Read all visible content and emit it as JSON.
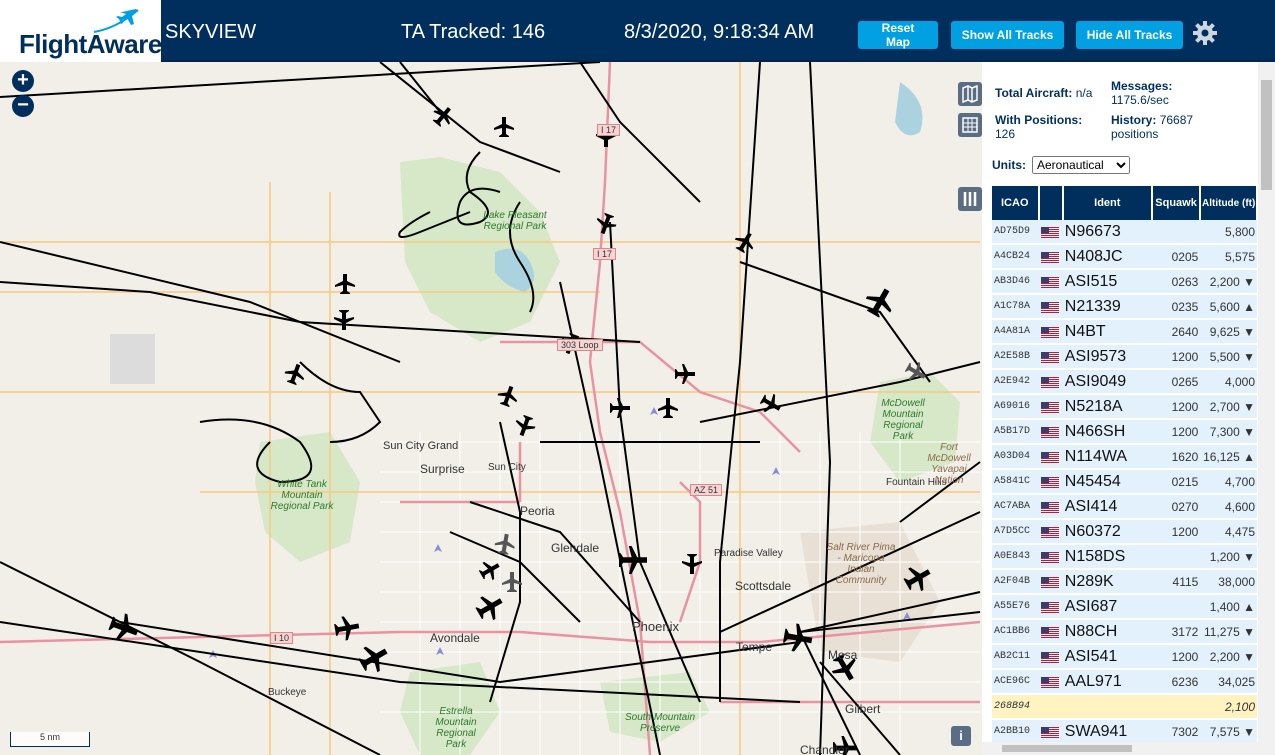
{
  "header": {
    "logo": "FlightAware",
    "app_name": "SKYVIEW",
    "tracked": "TA Tracked: 146",
    "datetime": "8/3/2020, 9:18:34 AM",
    "reset_map": "Reset Map",
    "show_tracks": "Show All Tracks",
    "hide_tracks": "Hide All Tracks"
  },
  "map": {
    "zoom_in": "+",
    "zoom_out": "−",
    "scale": "5 nm",
    "info": "i",
    "places": [
      "Sun City Grand",
      "Surprise",
      "Sun City",
      "Peoria",
      "Glendale",
      "Paradise Valley",
      "Scottsdale",
      "Avondale",
      "Phoenix",
      "Tempe",
      "Mesa",
      "Gilbert",
      "Chandler",
      "Buckeye",
      "Fountain Hills"
    ],
    "parks": [
      "Lake Pleasant Regional Park",
      "White Tank Mountain Regional Park",
      "McDowell Mountain Regional Park",
      "Fort McDowell Yavapai Nation",
      "Salt River Pima - Maricopa Indian Community",
      "Estrella Mountain Regional Park",
      "South Mountain Preserve"
    ],
    "shields": [
      "I 17",
      "I 17",
      "303 Loop",
      "AZ 51",
      "I 10"
    ]
  },
  "stats": {
    "total_label": "Total Aircraft:",
    "total_value": "n/a",
    "messages_label": "Messages:",
    "messages_value": "1175.6/sec",
    "positions_label": "With Positions:",
    "positions_value": "126",
    "history_label": "History:",
    "history_value": "76687 positions",
    "units_label": "Units:",
    "units_value": "Aeronautical"
  },
  "table": {
    "headers": {
      "icao": "ICAO",
      "ident": "Ident",
      "squawk": "Squawk",
      "altitude": "Altitude (ft)"
    },
    "rows": [
      {
        "icao": "AD75D9",
        "flag": "us",
        "ident": "N96673",
        "squawk": "",
        "alt": "5,800"
      },
      {
        "icao": "A4CB24",
        "flag": "us",
        "ident": "N408JC",
        "squawk": "0205",
        "alt": "5,575"
      },
      {
        "icao": "AB3D46",
        "flag": "us",
        "ident": "ASI515",
        "squawk": "0263",
        "alt": "2,200 ▼"
      },
      {
        "icao": "A1C78A",
        "flag": "us",
        "ident": "N21339",
        "squawk": "0235",
        "alt": "5,600 ▲"
      },
      {
        "icao": "A4A81A",
        "flag": "us",
        "ident": "N4BT",
        "squawk": "2640",
        "alt": "9,625 ▼"
      },
      {
        "icao": "A2E58B",
        "flag": "us",
        "ident": "ASI9573",
        "squawk": "1200",
        "alt": "5,500 ▼"
      },
      {
        "icao": "A2E942",
        "flag": "us",
        "ident": "ASI9049",
        "squawk": "0265",
        "alt": "4,000"
      },
      {
        "icao": "A69016",
        "flag": "us",
        "ident": "N5218A",
        "squawk": "1200",
        "alt": "2,700 ▼"
      },
      {
        "icao": "A5B17D",
        "flag": "us",
        "ident": "N466SH",
        "squawk": "1200",
        "alt": "7,300 ▼"
      },
      {
        "icao": "A03D04",
        "flag": "us",
        "ident": "N114WA",
        "squawk": "1620",
        "alt": "16,125 ▲"
      },
      {
        "icao": "A5841C",
        "flag": "us",
        "ident": "N45454",
        "squawk": "0215",
        "alt": "4,700"
      },
      {
        "icao": "AC7ABA",
        "flag": "us",
        "ident": "ASI414",
        "squawk": "0270",
        "alt": "4,600"
      },
      {
        "icao": "A7D5CC",
        "flag": "us",
        "ident": "N60372",
        "squawk": "1200",
        "alt": "4,475"
      },
      {
        "icao": "A0E843",
        "flag": "us",
        "ident": "N158DS",
        "squawk": "",
        "alt": "1,200 ▼"
      },
      {
        "icao": "A2F04B",
        "flag": "us",
        "ident": "N289K",
        "squawk": "4115",
        "alt": "38,000"
      },
      {
        "icao": "A55E76",
        "flag": "us",
        "ident": "ASI687",
        "squawk": "",
        "alt": "1,400 ▲"
      },
      {
        "icao": "AC1BB6",
        "flag": "us",
        "ident": "N88CH",
        "squawk": "3172",
        "alt": "11,275 ▼"
      },
      {
        "icao": "AB2C11",
        "flag": "us",
        "ident": "ASI541",
        "squawk": "1200",
        "alt": "2,200 ▼"
      },
      {
        "icao": "ACE96C",
        "flag": "us",
        "ident": "AAL971",
        "squawk": "6236",
        "alt": "34,025"
      },
      {
        "icao": "268B94",
        "flag": "",
        "ident": "",
        "squawk": "",
        "alt": "2,100",
        "highlight": true
      },
      {
        "icao": "A2BB10",
        "flag": "us",
        "ident": "SWA941",
        "squawk": "7302",
        "alt": "7,575 ▼"
      }
    ]
  },
  "colors": {
    "header_bg": "#002f5d",
    "button_bg": "#00a0e2",
    "row_bg": "#e3f1fc",
    "highlight_row": "#fff3c2"
  }
}
